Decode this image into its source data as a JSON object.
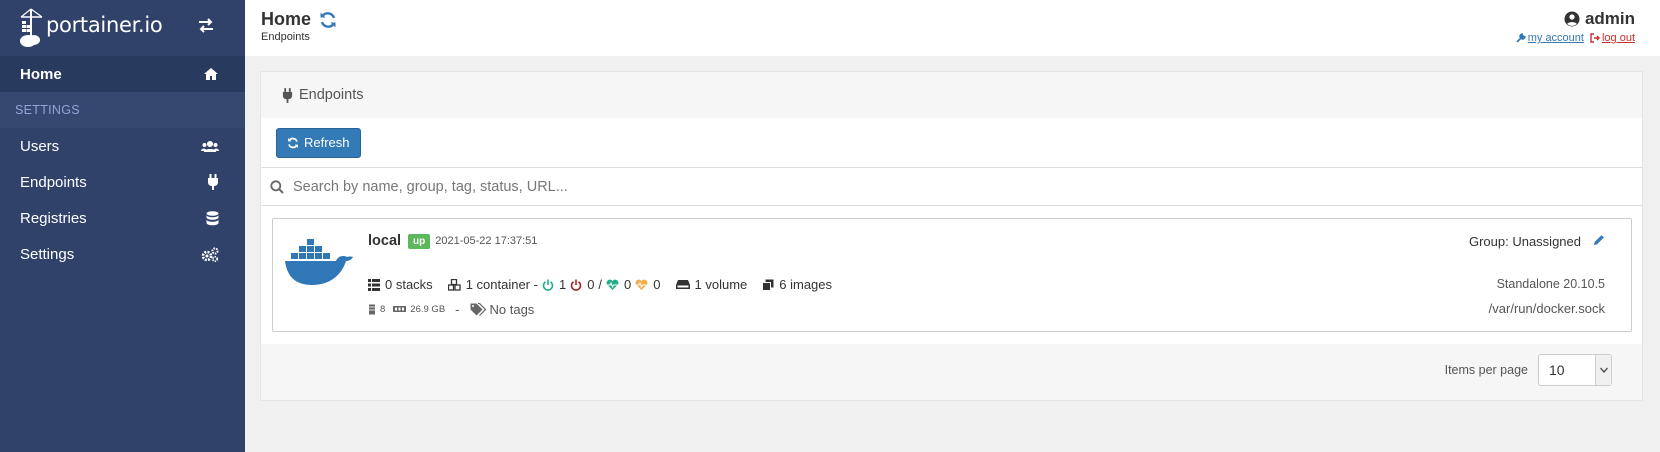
{
  "sidebar": {
    "logo_text": "portainer.io",
    "items": [
      {
        "label": "Home",
        "icon": "home-icon"
      },
      {
        "label": "Users",
        "icon": "users-icon"
      },
      {
        "label": "Endpoints",
        "icon": "plug-icon"
      },
      {
        "label": "Registries",
        "icon": "database-icon"
      },
      {
        "label": "Settings",
        "icon": "cogs-icon"
      }
    ],
    "section_label": "SETTINGS"
  },
  "header": {
    "title": "Home",
    "breadcrumb": "Endpoints",
    "user": "admin",
    "my_account": "my account",
    "log_out": "log out"
  },
  "panel": {
    "title": "Endpoints",
    "refresh_label": "Refresh",
    "search_placeholder": "Search by name, group, tag, status, URL..."
  },
  "endpoint": {
    "name": "local",
    "status": "up",
    "date": "2021-05-22 17:37:51",
    "group": "Group: Unassigned",
    "stacks": "0 stacks",
    "containers": "1 container -",
    "running": "1",
    "stopped": "0",
    "separator": "/",
    "healthy": "0",
    "unhealthy": "0",
    "volumes": "1 volume",
    "images": "6 images",
    "version": "Standalone 20.10.5",
    "cpu": "8",
    "memory": "26.9 GB",
    "dash": "-",
    "tags": "No tags",
    "url": "/var/run/docker.sock"
  },
  "footer": {
    "items_per_page_label": "Items per page",
    "items_per_page_value": "10"
  },
  "colors": {
    "sidebar_bg": "#30426a",
    "primary": "#337ab7",
    "success": "#5cb85c",
    "danger": "#c9302c",
    "docker_blue": "#2f77b7"
  }
}
